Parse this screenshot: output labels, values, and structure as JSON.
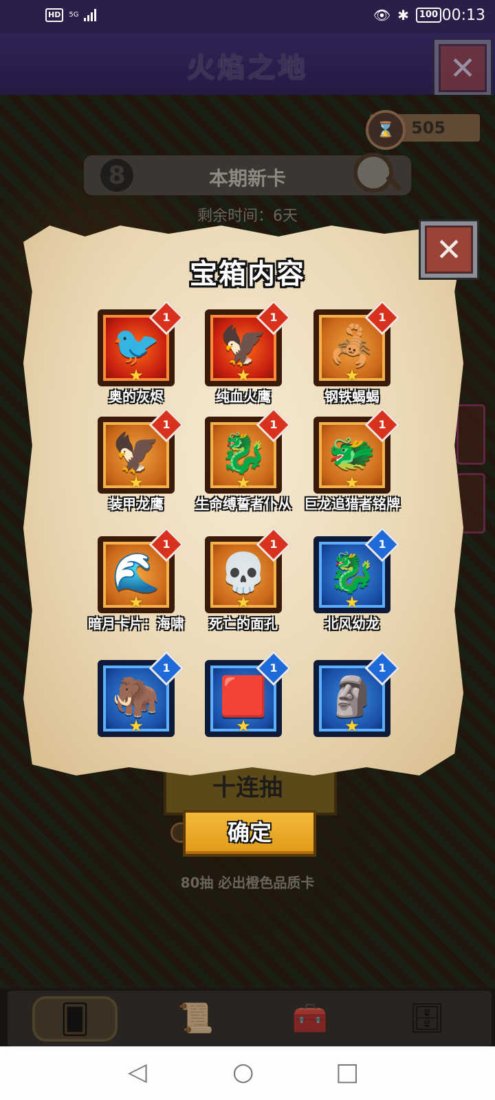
{
  "status_bar": {
    "hd": "HD",
    "network": "5G",
    "battery": "100",
    "time": "00:13"
  },
  "header": {
    "title": "火焰之地"
  },
  "currency": {
    "value": "505"
  },
  "pool": {
    "badge": "8",
    "title": "本期新卡",
    "remaining": "剩余时间：6天"
  },
  "modal": {
    "title": "宝箱内容",
    "cards": [
      {
        "name": "奥的灰烬",
        "level": "1",
        "rarity": "red",
        "icon": "phoenix-icon",
        "glyph": "🐦"
      },
      {
        "name": "纯血火鹰",
        "level": "1",
        "rarity": "red",
        "icon": "fire-hawk-icon",
        "glyph": "🦅"
      },
      {
        "name": "钢铁蝎蝎",
        "level": "1",
        "rarity": "orange",
        "icon": "scorpion-icon",
        "glyph": "🦂"
      },
      {
        "name": "装甲龙鹰",
        "level": "1",
        "rarity": "orange",
        "icon": "armored-gryphon-icon",
        "glyph": "🦅"
      },
      {
        "name": "生命缚誓者仆从",
        "level": "1",
        "rarity": "orange",
        "icon": "red-dragon-icon",
        "glyph": "🐉"
      },
      {
        "name": "巨龙追猎者铭牌",
        "level": "1",
        "rarity": "orange",
        "icon": "dragon-medallion-icon",
        "glyph": "🐲"
      },
      {
        "name": "暗月卡片：海啸",
        "level": "1",
        "rarity": "orange",
        "icon": "tsunami-card-icon",
        "glyph": "🌊"
      },
      {
        "name": "死亡的面孔",
        "level": "1",
        "rarity": "orange",
        "icon": "skull-icon",
        "glyph": "💀"
      },
      {
        "name": "北风幼龙",
        "level": "1",
        "rarity": "blue",
        "icon": "blue-drake-icon",
        "glyph": "🐉"
      },
      {
        "name": "",
        "level": "1",
        "rarity": "blue",
        "icon": "mammoth-icon",
        "glyph": "🦣"
      },
      {
        "name": "",
        "level": "1",
        "rarity": "blue",
        "icon": "flying-carpet-icon",
        "glyph": "🟥"
      },
      {
        "name": "",
        "level": "1",
        "rarity": "blue",
        "icon": "rune-stone-icon",
        "glyph": "🗿"
      }
    ],
    "star": "★"
  },
  "draw": {
    "ten_label": "十连抽",
    "confirm_label": "确定",
    "guarantee": "80抽 必出橙色品质卡"
  },
  "game_nav": [
    {
      "icon": "card-deck-icon",
      "glyph": "🂠",
      "active": true
    },
    {
      "icon": "quest-scroll-icon",
      "glyph": "📜",
      "active": false
    },
    {
      "icon": "treasure-chest-icon",
      "glyph": "🧰",
      "active": false
    },
    {
      "icon": "shelf-icon",
      "glyph": "🗄",
      "active": false
    }
  ],
  "system_nav": {
    "back": "◁",
    "home": "○",
    "recents": "□"
  }
}
